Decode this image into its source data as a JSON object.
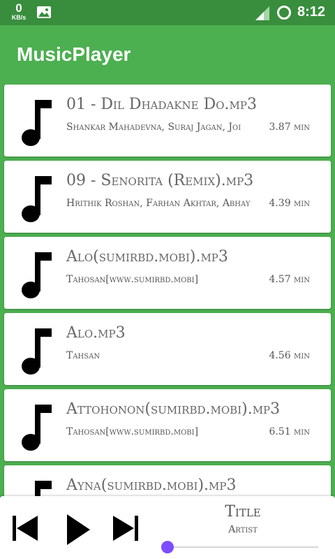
{
  "status_bar": {
    "net_value": "0",
    "net_unit": "KB/s",
    "time": "8:12",
    "icons": [
      "image-icon",
      "signal-icon",
      "circle-icon"
    ]
  },
  "app_bar": {
    "title": "MusicPlayer"
  },
  "songs": [
    {
      "title": "01 - Dil Dhadakne Do.mp3",
      "artist": "Shankar Mahadevna, Suraj Jagan, Joi",
      "duration": "3.87 min"
    },
    {
      "title": "09 - Senorita (Remix).mp3",
      "artist": "Hrithik Roshan, Farhan Akhtar, Abhay",
      "duration": "4.39 min"
    },
    {
      "title": "Alo(sumirbd.mobi).mp3",
      "artist": "Tahosan[www.sumirbd.mobi]",
      "duration": "4.57 min"
    },
    {
      "title": "Alo.mp3",
      "artist": "Tahsan",
      "duration": "4.56 min"
    },
    {
      "title": "Attohonon(sumirbd.mobi).mp3",
      "artist": "Tahosan[www.sumirbd.mobi]",
      "duration": "6.51 min"
    },
    {
      "title": "Ayna(sumirbd.mobi).mp3",
      "artist": "",
      "duration": ""
    }
  ],
  "player": {
    "title": "Title",
    "artist": "Artist",
    "progress": 0,
    "accent_color": "#7C4DFF",
    "controls": [
      "previous-icon",
      "play-icon",
      "next-icon"
    ]
  },
  "colors": {
    "primary": "#4CAF50",
    "primary_dark": "#388E3C"
  }
}
